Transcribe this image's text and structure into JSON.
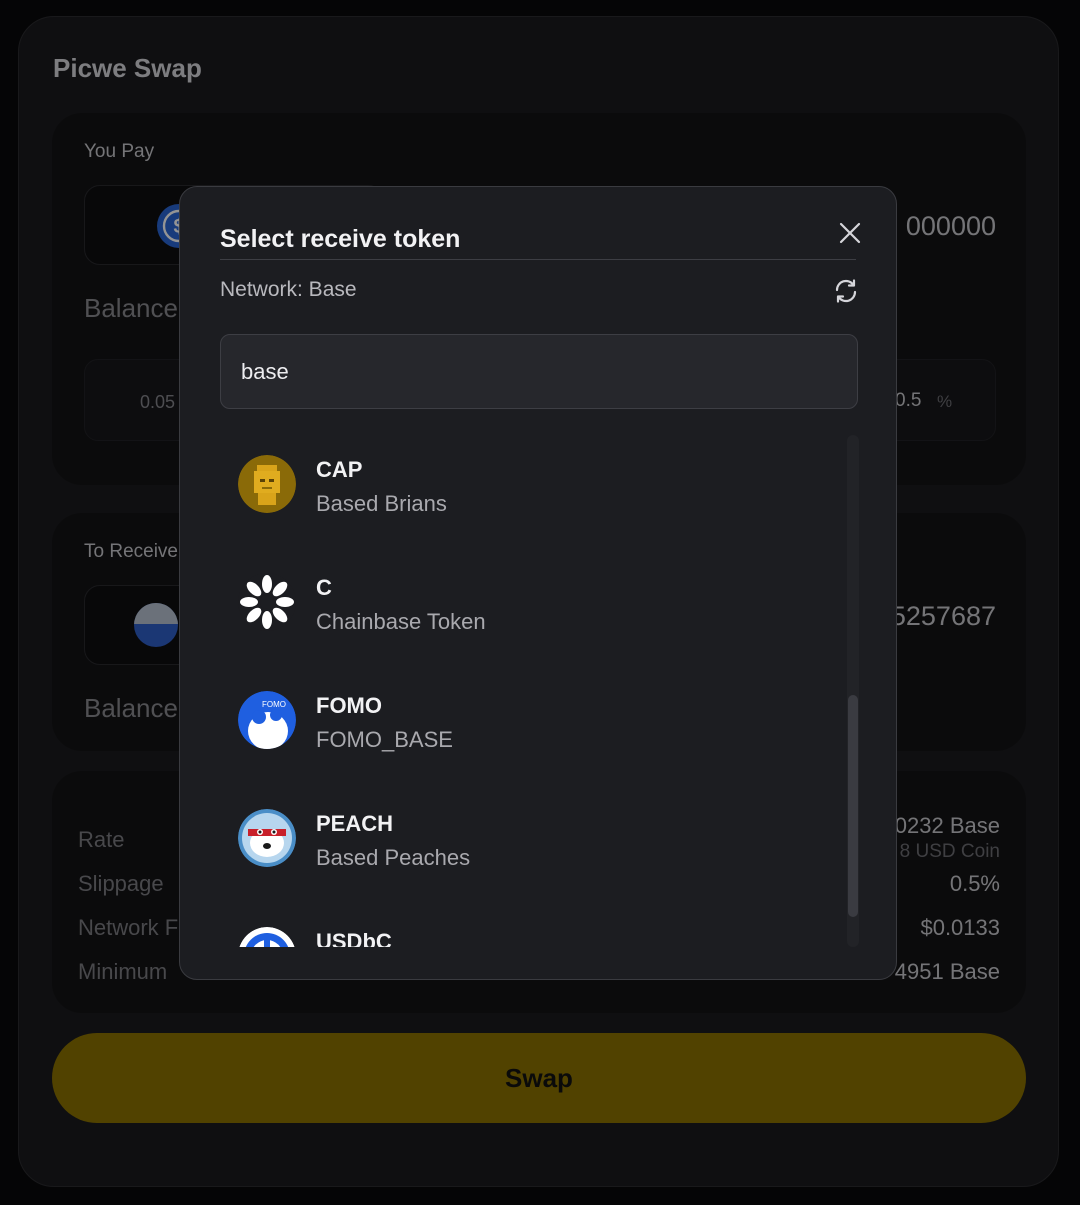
{
  "app": {
    "title": "Picwe Swap"
  },
  "pay": {
    "label": "You Pay",
    "amount": "000000",
    "balance_label": "Balance",
    "left_value": "0.05",
    "slippage_value": "0.5",
    "slippage_unit": "%"
  },
  "receive": {
    "label": "To Receive",
    "amount": "5257687",
    "balance_label": "Balance"
  },
  "info": {
    "rate_label": "Rate",
    "rate_value": "0232 Base",
    "rate_sub": "8 USD Coin",
    "slippage_label": "Slippage",
    "slippage_value": "0.5%",
    "network_fee_label": "Network F",
    "network_fee_value": "$0.0133",
    "minimum_label": "Minimum",
    "minimum_value": "4951 Base"
  },
  "swap_button": {
    "label": "Swap"
  },
  "modal": {
    "title": "Select receive token",
    "network_label": "Network: Base",
    "search_value": "base",
    "tokens": [
      {
        "symbol": "CAP",
        "name": "Based Brians",
        "icon": "based-brians-icon"
      },
      {
        "symbol": "C",
        "name": "Chainbase Token",
        "icon": "chainbase-icon"
      },
      {
        "symbol": "FOMO",
        "name": "FOMO_BASE",
        "icon": "fomo-icon",
        "icon_text": "FOMO"
      },
      {
        "symbol": "PEACH",
        "name": "Based Peaches",
        "icon": "peach-icon"
      },
      {
        "symbol": "USDbC",
        "name": "",
        "icon": "usdbc-icon"
      }
    ]
  },
  "colors": {
    "accent": "#8c7200",
    "modal_bg": "#1c1d21",
    "app_bg": "#1b1b1e"
  }
}
